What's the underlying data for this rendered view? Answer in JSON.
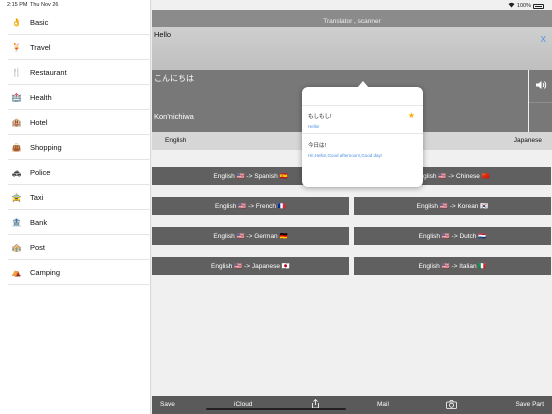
{
  "status_bar": {
    "time": "2:15 PM",
    "date": "Thu Nov 26",
    "battery": "100%"
  },
  "sidebar": {
    "items": [
      {
        "label": "Basic",
        "icon": "hand-icon",
        "glyph": "👌"
      },
      {
        "label": "Travel",
        "icon": "cocktail-icon",
        "glyph": "🍹"
      },
      {
        "label": "Restaurant",
        "icon": "cutlery-icon",
        "glyph": "🍴"
      },
      {
        "label": "Health",
        "icon": "hospital-icon",
        "glyph": "🏥"
      },
      {
        "label": "Hotel",
        "icon": "hotel-icon",
        "glyph": "🏨"
      },
      {
        "label": "Shopping",
        "icon": "shopping-bag-icon",
        "glyph": "👜"
      },
      {
        "label": "Police",
        "icon": "police-car-icon",
        "glyph": "🚓"
      },
      {
        "label": "Taxi",
        "icon": "taxi-icon",
        "glyph": "🚖"
      },
      {
        "label": "Bank",
        "icon": "bank-icon",
        "glyph": "🏦"
      },
      {
        "label": "Post",
        "icon": "post-office-icon",
        "glyph": "🏤"
      },
      {
        "label": "Camping",
        "icon": "tent-icon",
        "glyph": "⛺"
      }
    ]
  },
  "header": {
    "title": "Translator , scanner"
  },
  "input": {
    "text": "Hello",
    "clear_label": "X"
  },
  "output": {
    "native": "こんにちは",
    "romanized": "Kon'nichiwa"
  },
  "language_bar": {
    "source": "English",
    "target": "Japanese"
  },
  "pairs": [
    {
      "label": "English 🇺🇸 -> Spanish 🇪🇸"
    },
    {
      "label": "English 🇺🇸 -> Chinese 🇨🇳"
    },
    {
      "label": "English 🇺🇸 -> French 🇫🇷"
    },
    {
      "label": "English 🇺🇸 -> Korean 🇰🇷"
    },
    {
      "label": "English 🇺🇸 -> German 🇩🇪"
    },
    {
      "label": "English 🇺🇸 -> Dutch 🇳🇱"
    },
    {
      "label": "English 🇺🇸 -> Japanese 🇯🇵"
    },
    {
      "label": "English 🇺🇸 -> Italian 🇮🇹"
    }
  ],
  "popup": {
    "entries": [
      {
        "native": "もしもし!",
        "translation": "Hello!"
      },
      {
        "native": "今日は!",
        "translation": "Hi!,Hello!,Good afternoon!,Good day!"
      }
    ]
  },
  "toolbar": {
    "save": "Save",
    "icloud": "iCloud",
    "share_icon": "share-icon",
    "mail": "Mail",
    "camera_icon": "camera-icon",
    "save_part": "Save Part"
  },
  "colors": {
    "accent": "#4a8fe0",
    "button_bg": "#606060",
    "star": "#f0b400"
  }
}
